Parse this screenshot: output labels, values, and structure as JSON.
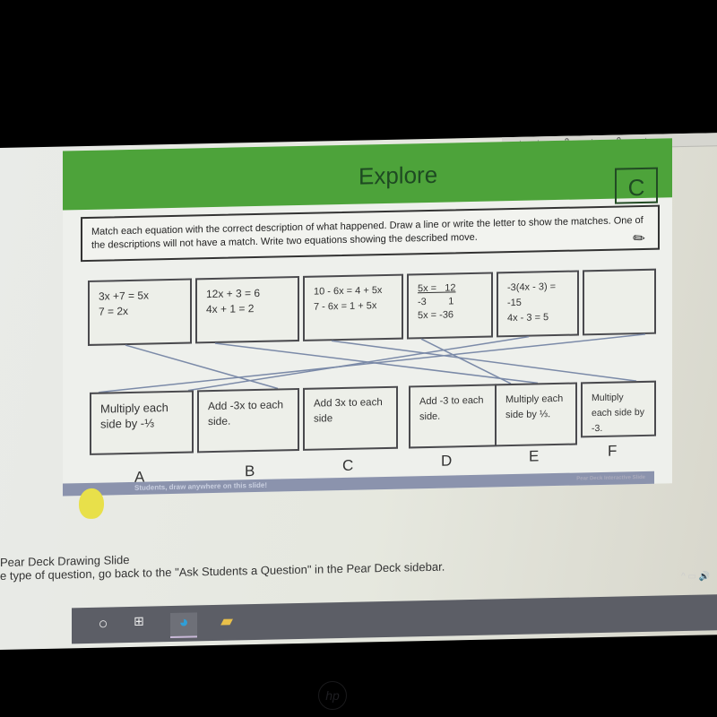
{
  "ruler": {
    "marks": [
      "8",
      "9"
    ]
  },
  "slide": {
    "title": "Explore",
    "badge": "C",
    "instructions": "Match each equation with the correct description of what happened. Draw a line or write the letter  to show the matches. One of the descriptions will not have a match. Write two equations showing the described move.",
    "equations": [
      {
        "line1": "3x +7 = 5x",
        "line2": "7 = 2x",
        "line3": ""
      },
      {
        "line1": "12x + 3 = 6",
        "line2": "4x + 1 = 2",
        "line3": ""
      },
      {
        "line1": "10 - 6x = 4 + 5x",
        "line2": "7 - 6x = 1 + 5x",
        "line3": ""
      },
      {
        "line1": "5x =   12",
        "line2": "-3        1",
        "line3": "5x = -36"
      },
      {
        "line1": "-3(4x - 3) = -15",
        "line2": "4x - 3 = 5",
        "line3": ""
      },
      {
        "line1": "",
        "line2": "",
        "line3": ""
      }
    ],
    "descriptions": [
      {
        "letter": "A",
        "text": "Multiply each side by -⅓"
      },
      {
        "letter": "B",
        "text": "Add -3x to each side."
      },
      {
        "letter": "C",
        "text": "Add 3x to each side"
      },
      {
        "letter": "D",
        "text": "Add -3 to each side."
      },
      {
        "letter": "E",
        "text": "Multiply each side by ⅓."
      },
      {
        "letter": "F",
        "text": "Multiply each side by -3."
      }
    ],
    "peardeck_bar": "Students, draw anywhere on this slide!",
    "peardeck_bar_right": "Pear Deck Interactive Slide"
  },
  "notes": {
    "line1": "Pear Deck Drawing Slide",
    "line2": "e type of question, go back to the \"Ask Students a Question\" in the Pear Deck sidebar."
  },
  "taskbar": {
    "items": [
      "search-icon",
      "task-view-icon",
      "edge-icon",
      "file-explorer-icon"
    ]
  },
  "tray": {
    "text": "^ ▭ 🔊"
  },
  "bezel": {
    "logo": "hp"
  }
}
